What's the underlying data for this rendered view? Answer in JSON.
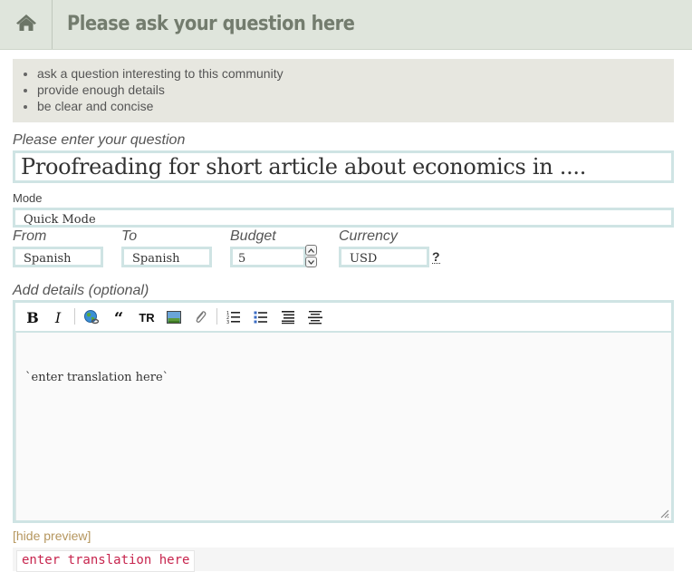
{
  "header": {
    "title": "Please ask your question here",
    "home_icon": "home-icon"
  },
  "tips": [
    "ask a question interesting to this community",
    "provide enough details",
    "be clear and concise"
  ],
  "question": {
    "label": "Please enter your question",
    "value": "Proofreading for short article about economics in ...."
  },
  "mode": {
    "label": "Mode",
    "value": "Quick Mode"
  },
  "from": {
    "label": "From",
    "value": "Spanish"
  },
  "to": {
    "label": "To",
    "value": "Spanish"
  },
  "budget": {
    "label": "Budget",
    "value": "5"
  },
  "currency": {
    "label": "Currency",
    "value": "USD",
    "help": "?"
  },
  "details": {
    "label": "Add details (optional)",
    "toolbar": {
      "bold": "B",
      "italic": "I",
      "quote": "66",
      "translate": "TR"
    },
    "body": "`enter translation here`"
  },
  "preview": {
    "toggle": "[hide preview]",
    "code": "enter translation here"
  },
  "colors": {
    "header_bg": "#dfe5dc",
    "field_border": "#cfe4e4",
    "link": "#b5965e",
    "code": "#c7254e"
  }
}
